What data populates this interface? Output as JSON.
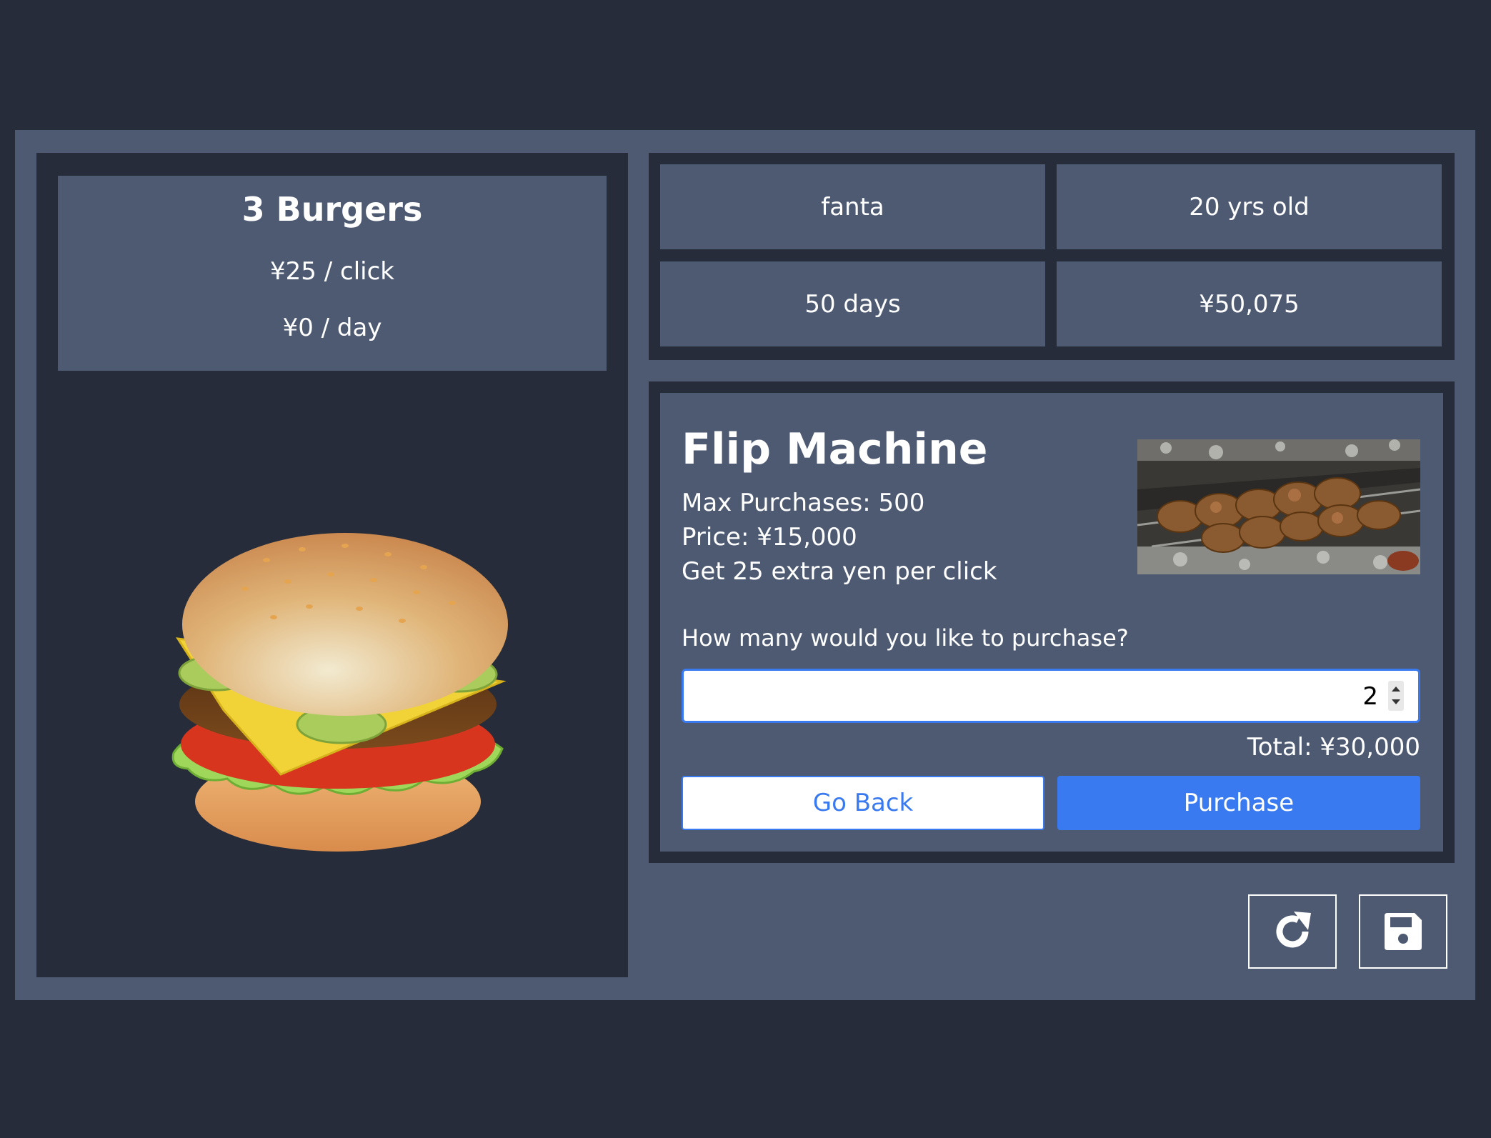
{
  "stats": {
    "burgers": "3 Burgers",
    "per_click": "¥25 / click",
    "per_day": "¥0 / day"
  },
  "user": {
    "name": "fanta",
    "age": "20 yrs old",
    "days": "50 days",
    "money": "¥50,075"
  },
  "item": {
    "title": "Flip Machine",
    "max": "Max Purchases: 500",
    "price": "Price: ¥15,000",
    "description": "Get 25 extra yen per click",
    "image_icon": "grilled-skewers-image"
  },
  "purchase": {
    "question": "How many would you like to purchase?",
    "quantity": "2",
    "total": "Total: ¥30,000",
    "back_label": "Go Back",
    "purchase_label": "Purchase"
  },
  "icons": {
    "burger": "burger-icon",
    "reset": "redo-icon",
    "save": "floppy-disk-icon"
  },
  "colors": {
    "background": "#262c3a",
    "panel": "#4e5a72",
    "accent": "#3a7af0"
  }
}
